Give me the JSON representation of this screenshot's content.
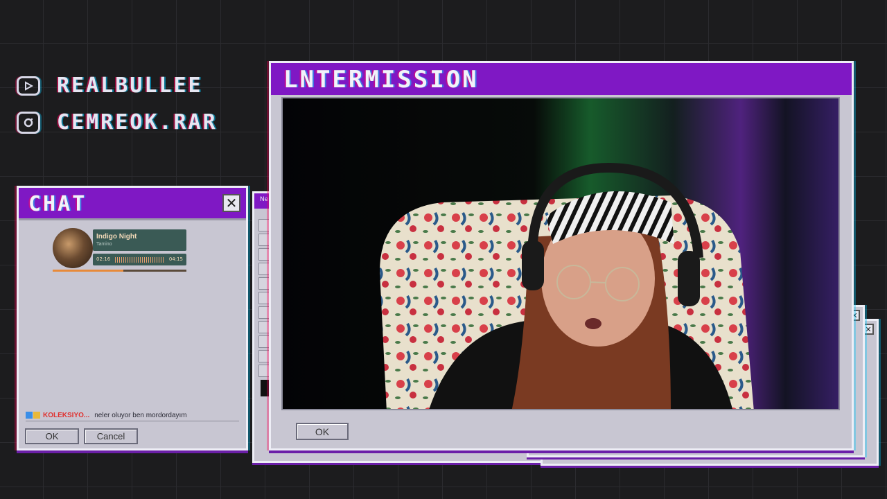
{
  "socials": [
    {
      "platform": "youtube-icon",
      "handle": "REALBULLEE"
    },
    {
      "platform": "instagram-icon",
      "handle": "CEMREOK.RAR"
    }
  ],
  "chat_window": {
    "title": "CHAT",
    "close_icon": "close-icon",
    "now_playing": {
      "track": "Indigo Night",
      "artist": "Tamino",
      "elapsed": "02:16",
      "total": "04:15",
      "progress": 0.53
    },
    "message": {
      "badges": [
        "badge-icon",
        "badge-icon"
      ],
      "user": "KOLEKSIYO...",
      "text": "neler oluyor ben mordordayım"
    },
    "ok_label": "OK",
    "cancel_label": "Cancel"
  },
  "paint_window": {
    "title_fragment": "Ne"
  },
  "main_window": {
    "title": "LNTERMISSION",
    "ok_label": "OK"
  },
  "colors": {
    "titlebar": "#7f18c4",
    "window_body": "#c8c6d2",
    "music_card": "#3a5a55",
    "accent_orange": "#e88a3a",
    "username_red": "#e0312f"
  }
}
